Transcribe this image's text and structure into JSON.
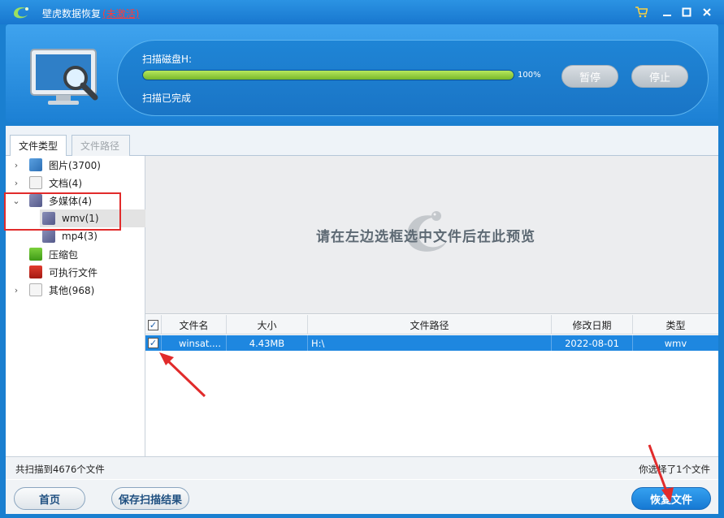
{
  "title_bar": {
    "app_name": "壁虎数据恢复",
    "inactive_label": "(未激活)",
    "buttons": [
      "cart-icon",
      "minimize-icon",
      "maximize-icon",
      "close-icon"
    ]
  },
  "scan": {
    "disk_label": "扫描磁盘H:",
    "progress": 1.0,
    "percent_text": "100%",
    "status_text": "扫描已完成",
    "pause_label": "暂停",
    "stop_label": "停止"
  },
  "tabs": [
    {
      "label": "文件类型",
      "active": true
    },
    {
      "label": "文件路径",
      "active": false
    }
  ],
  "tree": {
    "items": [
      {
        "label": "图片(3700)",
        "icon": "image-icon"
      },
      {
        "label": "文档(4)",
        "icon": "document-icon"
      },
      {
        "label": "多媒体(4)",
        "icon": "media-icon"
      },
      {
        "label": "wmv(1)",
        "icon": "media-icon"
      },
      {
        "label": "mp4(3)",
        "icon": "media-icon"
      },
      {
        "label": "压缩包",
        "icon": "archive-icon"
      },
      {
        "label": "可执行文件",
        "icon": "executable-icon"
      },
      {
        "label": "其他(968)",
        "icon": "other-file-icon"
      }
    ]
  },
  "preview": {
    "hint": "请在左边选框选中文件后在此预览"
  },
  "table": {
    "headers": [
      "文件名",
      "大小",
      "文件路径",
      "修改日期",
      "类型"
    ],
    "rows": [
      {
        "name": "winsat....",
        "size": "4.43MB",
        "path": "H:\\",
        "date": "2022-08-01",
        "type": "wmv",
        "checked": true
      }
    ]
  },
  "status": {
    "left": "共扫描到4676个文件",
    "right": "你选择了1个文件"
  },
  "footer": {
    "home_label": "首页",
    "save_label": "保存扫描结果",
    "recover_label": "恢复文件"
  },
  "colors": {
    "title_bar": "#1877cf",
    "progress_fill": "#9bd240",
    "selection": "#1e87e0",
    "annotation": "#e12b2b"
  }
}
